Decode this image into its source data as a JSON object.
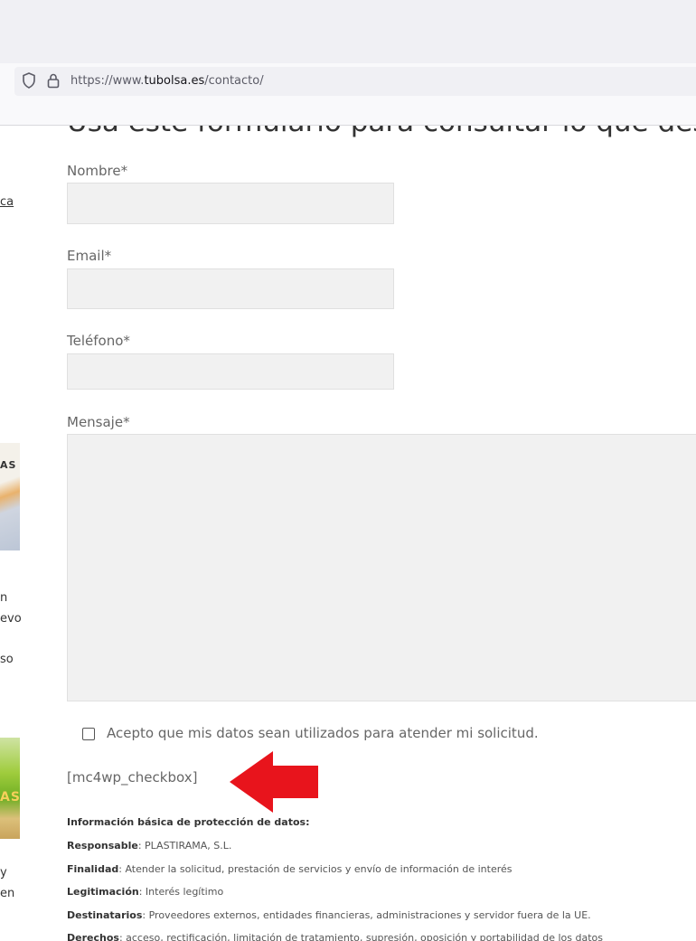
{
  "browser": {
    "url_prefix": "https://www.",
    "url_domain": "tubolsa.es",
    "url_path": "/contacto/"
  },
  "sidebar": {
    "fragments": [
      "ca",
      "n",
      "evo",
      "so",
      "y",
      "en"
    ],
    "banner1_text": "AS",
    "banner2_text": "AS"
  },
  "form": {
    "heading": "Usa este formulario para consultar lo que desees",
    "name_label": "Nombre*",
    "email_label": "Email*",
    "phone_label": "Teléfono*",
    "message_label": "Mensaje*",
    "consent_label": "Acepto que mis datos sean utilizados para atender mi solicitud.",
    "shortcode": "[mc4wp_checkbox]"
  },
  "privacy": {
    "title": "Información básica de protección de datos:",
    "rows": [
      {
        "key": "Responsable",
        "value": ": PLASTIRAMA, S.L."
      },
      {
        "key": "Finalidad",
        "value": ": Atender la solicitud, prestación de servicios y envío de información de interés"
      },
      {
        "key": "Legitimación",
        "value": ": Interés legítimo"
      },
      {
        "key": "Destinatarios",
        "value": ": Proveedores externos, entidades financieras, administraciones y servidor fuera de la UE."
      },
      {
        "key": "Derechos",
        "value": ": acceso, rectificación, limitación de tratamiento, supresión, oposición y portabilidad de los datos"
      }
    ]
  },
  "colors": {
    "arrow": "#e8141c",
    "field_bg": "#f1f1f1"
  }
}
